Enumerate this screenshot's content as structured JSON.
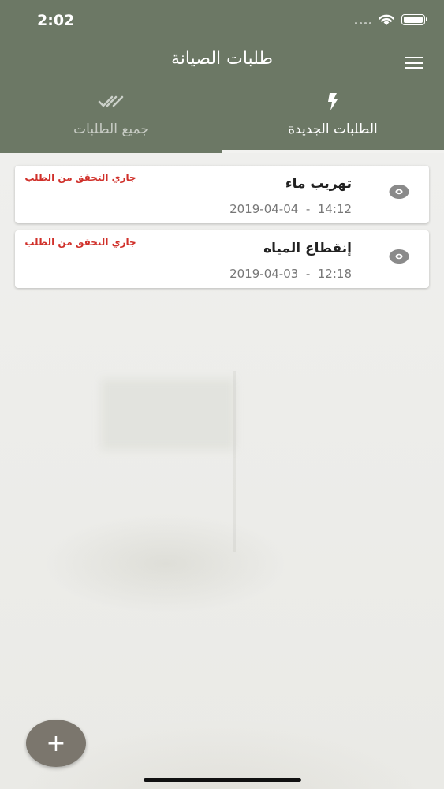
{
  "status_bar": {
    "time": "2:02"
  },
  "header": {
    "title": "طلبات الصيانة"
  },
  "tabs": [
    {
      "label": "الطلبات الجديدة",
      "icon": "bolt-icon",
      "active": true
    },
    {
      "label": "جميع الطلبات",
      "icon": "double-check-icon",
      "active": false
    }
  ],
  "requests": [
    {
      "title": "تهريب ماء",
      "date": "2019-04-04  -  14:12",
      "status": "جاري التحقق من الطلب"
    },
    {
      "title": "إنقطاع المياه",
      "date": "2019-04-03  -  12:18",
      "status": "جاري التحقق من الطلب"
    }
  ],
  "fab": {
    "label": "+"
  },
  "colors": {
    "primary": "#6c7865",
    "status_red": "#d0302a",
    "fab": "#7b766d"
  }
}
